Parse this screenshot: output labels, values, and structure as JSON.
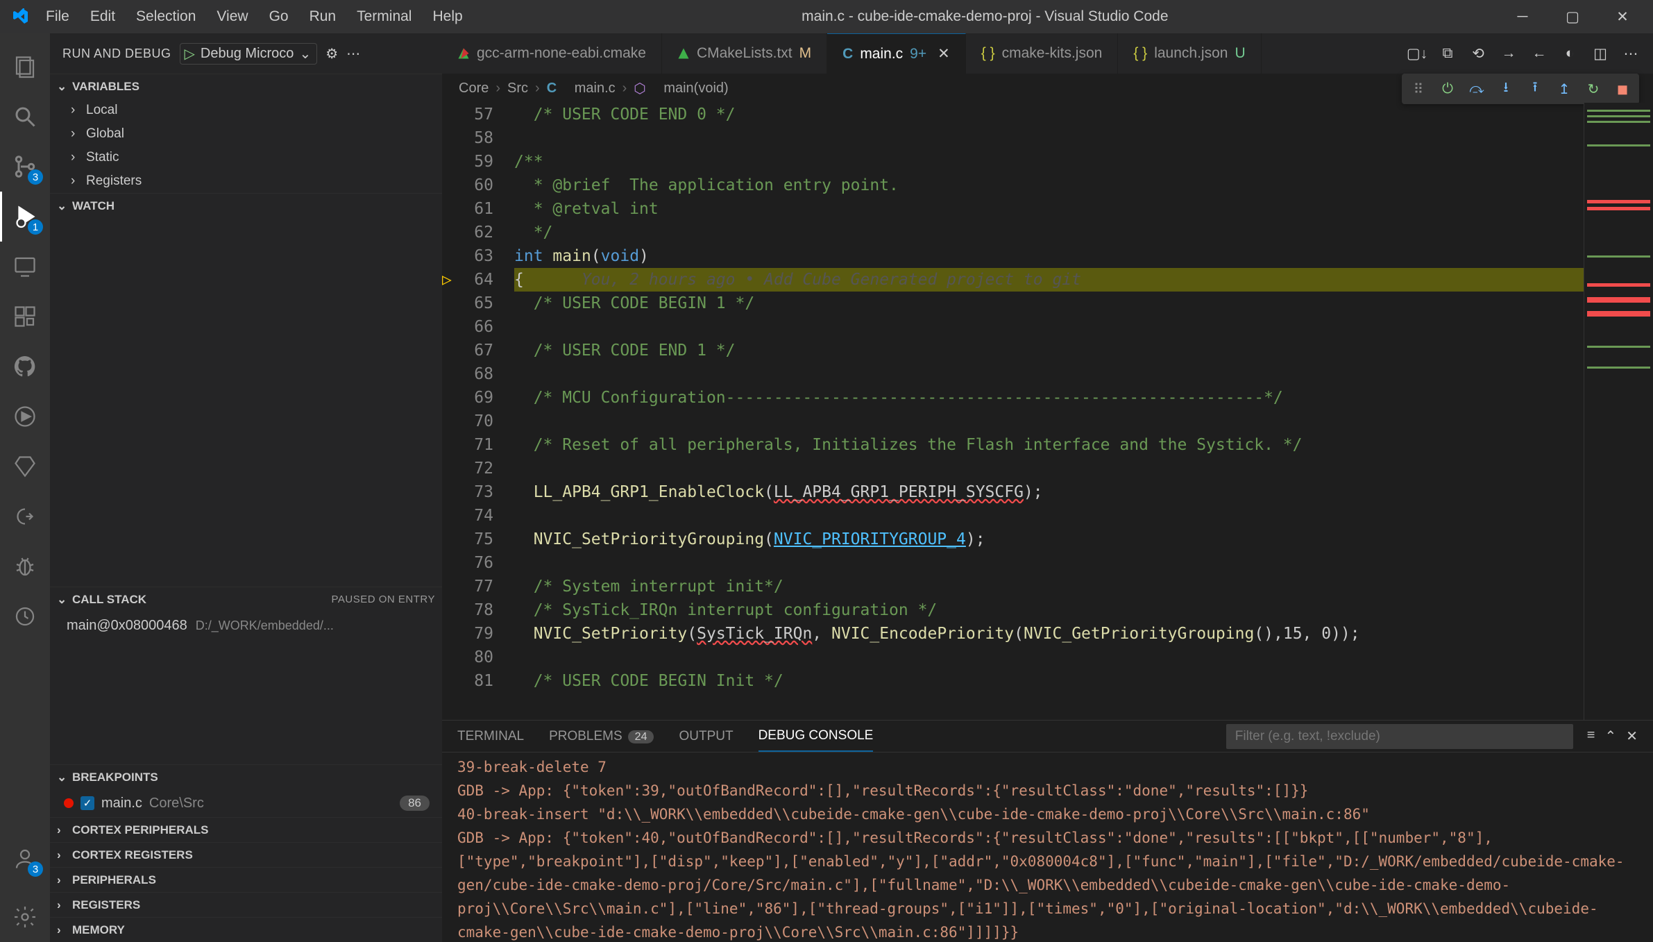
{
  "menu": [
    "File",
    "Edit",
    "Selection",
    "View",
    "Go",
    "Run",
    "Terminal",
    "Help"
  ],
  "title": "main.c - cube-ide-cmake-demo-proj - Visual Studio Code",
  "run_debug_label": "RUN AND DEBUG",
  "run_config": "Debug Microco",
  "sections": {
    "variables": "VARIABLES",
    "watch": "WATCH",
    "callstack": "CALL STACK",
    "callstack_state": "PAUSED ON ENTRY",
    "breakpoints": "BREAKPOINTS",
    "cortex_periph": "CORTEX PERIPHERALS",
    "cortex_reg": "CORTEX REGISTERS",
    "peripherals": "PERIPHERALS",
    "registers": "REGISTERS",
    "memory": "MEMORY"
  },
  "var_scopes": [
    "Local",
    "Global",
    "Static",
    "Registers"
  ],
  "callstack_frame": {
    "name": "main@0x08000468",
    "path": "D:/_WORK/embedded/..."
  },
  "breakpoint": {
    "file": "main.c",
    "folder": "Core\\Src",
    "count": "86"
  },
  "tabs": [
    {
      "icon": "tri",
      "name": "gcc-arm-none-eabi.cmake",
      "mod": ""
    },
    {
      "icon": "tri",
      "name": "CMakeLists.txt",
      "mod": "M"
    },
    {
      "icon": "c",
      "name": "main.c",
      "mod": "9+",
      "active": true
    },
    {
      "icon": "json",
      "name": "cmake-kits.json",
      "mod": ""
    },
    {
      "icon": "json",
      "name": "launch.json",
      "mod": "U"
    }
  ],
  "breadcrumb": [
    "Core",
    "Src",
    "main.c",
    "main(void)"
  ],
  "code": [
    {
      "n": 57,
      "txt": "  /* USER CODE END 0 */",
      "cls": "c-comment"
    },
    {
      "n": 58,
      "txt": ""
    },
    {
      "n": 59,
      "txt": "/**",
      "cls": "c-comment"
    },
    {
      "n": 60,
      "txt": "  * @brief  The application entry point.",
      "cls": "c-comment"
    },
    {
      "n": 61,
      "txt": "  * @retval int",
      "cls": "c-comment"
    },
    {
      "n": 62,
      "txt": "  */",
      "cls": "c-comment"
    },
    {
      "n": 63,
      "txt": "int main(void)",
      "special": "sig"
    },
    {
      "n": 64,
      "txt": "{",
      "hl": true,
      "arrow": true,
      "hint": "      You, 2 hours ago • Add Cube Generated project to git"
    },
    {
      "n": 65,
      "txt": "  /* USER CODE BEGIN 1 */",
      "cls": "c-comment"
    },
    {
      "n": 66,
      "txt": ""
    },
    {
      "n": 67,
      "txt": "  /* USER CODE END 1 */",
      "cls": "c-comment"
    },
    {
      "n": 68,
      "txt": ""
    },
    {
      "n": 69,
      "txt": "  /* MCU Configuration--------------------------------------------------------*/",
      "cls": "c-comment"
    },
    {
      "n": 70,
      "txt": ""
    },
    {
      "n": 71,
      "txt": "  /* Reset of all peripherals, Initializes the Flash interface and the Systick. */",
      "cls": "c-comment"
    },
    {
      "n": 72,
      "txt": ""
    },
    {
      "n": 73,
      "txt": "  LL_APB4_GRP1_EnableClock(LL_APB4_GRP1_PERIPH_SYSCFG);",
      "special": "call1"
    },
    {
      "n": 74,
      "txt": ""
    },
    {
      "n": 75,
      "txt": "  NVIC_SetPriorityGrouping(NVIC_PRIORITYGROUP_4);",
      "special": "call2"
    },
    {
      "n": 76,
      "txt": ""
    },
    {
      "n": 77,
      "txt": "  /* System interrupt init*/",
      "cls": "c-comment"
    },
    {
      "n": 78,
      "txt": "  /* SysTick_IRQn interrupt configuration */",
      "cls": "c-comment"
    },
    {
      "n": 79,
      "txt": "  NVIC_SetPriority(SysTick_IRQn, NVIC_EncodePriority(NVIC_GetPriorityGrouping(),15, 0));",
      "special": "call3"
    },
    {
      "n": 80,
      "txt": ""
    },
    {
      "n": 81,
      "txt": "  /* USER CODE BEGIN Init */",
      "cls": "c-comment"
    }
  ],
  "panel": {
    "tabs": {
      "terminal": "TERMINAL",
      "problems": "PROBLEMS",
      "problems_count": "24",
      "output": "OUTPUT",
      "debug": "DEBUG CONSOLE"
    },
    "filter_ph": "Filter (e.g. text, !exclude)",
    "lines": [
      "39-break-delete 7",
      "GDB -> App: {\"token\":39,\"outOfBandRecord\":[],\"resultRecords\":{\"resultClass\":\"done\",\"results\":[]}}",
      "40-break-insert \"d:\\\\_WORK\\\\embedded\\\\cubeide-cmake-gen\\\\cube-ide-cmake-demo-proj\\\\Core\\\\Src\\\\main.c:86\"",
      "GDB -> App: {\"token\":40,\"outOfBandRecord\":[],\"resultRecords\":{\"resultClass\":\"done\",\"results\":[[\"bkpt\",[[\"number\",\"8\"],[\"type\",\"breakpoint\"],[\"disp\",\"keep\"],[\"enabled\",\"y\"],[\"addr\",\"0x080004c8\"],[\"func\",\"main\"],[\"file\",\"D:/_WORK/embedded/cubeide-cmake-gen/cube-ide-cmake-demo-proj/Core/Src/main.c\"],[\"fullname\",\"D:\\\\_WORK\\\\embedded\\\\cubeide-cmake-gen\\\\cube-ide-cmake-demo-proj\\\\Core\\\\Src\\\\main.c\"],[\"line\",\"86\"],[\"thread-groups\",[\"i1\"]],[\"times\",\"0\"],[\"original-location\",\"d:\\\\_WORK\\\\embedded\\\\cubeide-cmake-gen\\\\cube-ide-cmake-demo-proj\\\\Core\\\\Src\\\\main.c:86\"]]]]}}"
    ]
  },
  "activity_badges": {
    "scm": "3",
    "debug": "1",
    "accounts": "3"
  }
}
